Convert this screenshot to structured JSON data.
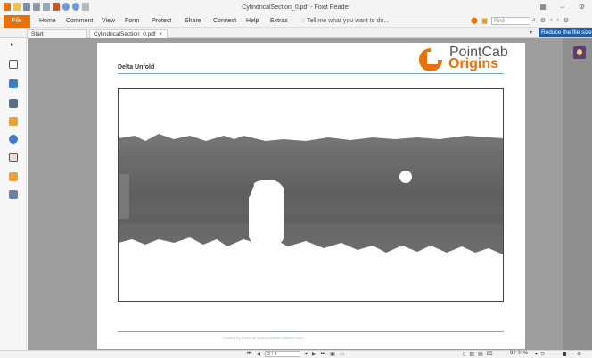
{
  "app": {
    "title": "CylindricalSection_0.pdf - Foxit Reader"
  },
  "ribbon": {
    "file_label": "File",
    "menu": [
      "Home",
      "Comment",
      "View",
      "Form",
      "Protect",
      "Share",
      "Connect",
      "Help",
      "Extras"
    ],
    "tell_me": "Tell me what you want to do...",
    "find_placeholder": "Find"
  },
  "tabs": [
    {
      "label": "Start"
    },
    {
      "label": "CylindricalSection_0.pdf"
    }
  ],
  "banner": {
    "label": "Reduce the file size"
  },
  "document": {
    "heading": "Delta Unfold",
    "logo_line1": "PointCab",
    "logo_line2": "Origins",
    "footer": "Created by PointCab (www.pointcab-software.com)"
  },
  "statusbar": {
    "page": "2 / 4",
    "zoom": "92.31%"
  },
  "colors": {
    "accent": "#e8710a",
    "banner": "#1f5ea8"
  }
}
